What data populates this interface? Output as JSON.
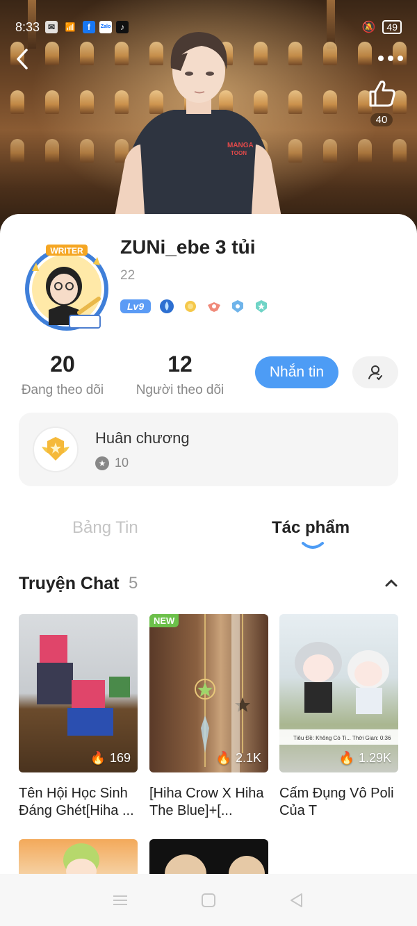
{
  "status_bar": {
    "time": "8:33",
    "battery": "49"
  },
  "header": {
    "likes": "40"
  },
  "profile": {
    "name": "ZUNi_ebe 3 tủi",
    "id": "22",
    "level": "Lv9",
    "avatar_badge": "WRITER"
  },
  "stats": {
    "following_count": "20",
    "following_label": "Đang theo dõi",
    "followers_count": "12",
    "followers_label": "Người theo dõi"
  },
  "actions": {
    "message_label": "Nhắn tin"
  },
  "medal": {
    "title": "Huân chương",
    "count": "10"
  },
  "tabs": [
    {
      "label": "Bảng Tin",
      "active": false
    },
    {
      "label": "Tác phẩm",
      "active": true
    }
  ],
  "section": {
    "title": "Truyện Chat",
    "count": "5"
  },
  "stories": [
    {
      "title": "Tên Hội Học Sinh Đáng Ghét[Hiha ...",
      "views": "169",
      "is_new": false
    },
    {
      "title": "[Hiha Crow X Hiha The Blue]+[...",
      "views": "2.1K",
      "is_new": true,
      "tag": "NEW"
    },
    {
      "title": "Cấm Đụng Vô Poli Của T",
      "views": "1.29K",
      "is_new": false,
      "caption": "Tiêu Đề: Không Có Ti...  Thời Gian:    0:36"
    }
  ],
  "colors": {
    "accent": "#4d9cf5",
    "new_tag": "#6cc04a",
    "level_badge": "#5b9bf5"
  }
}
